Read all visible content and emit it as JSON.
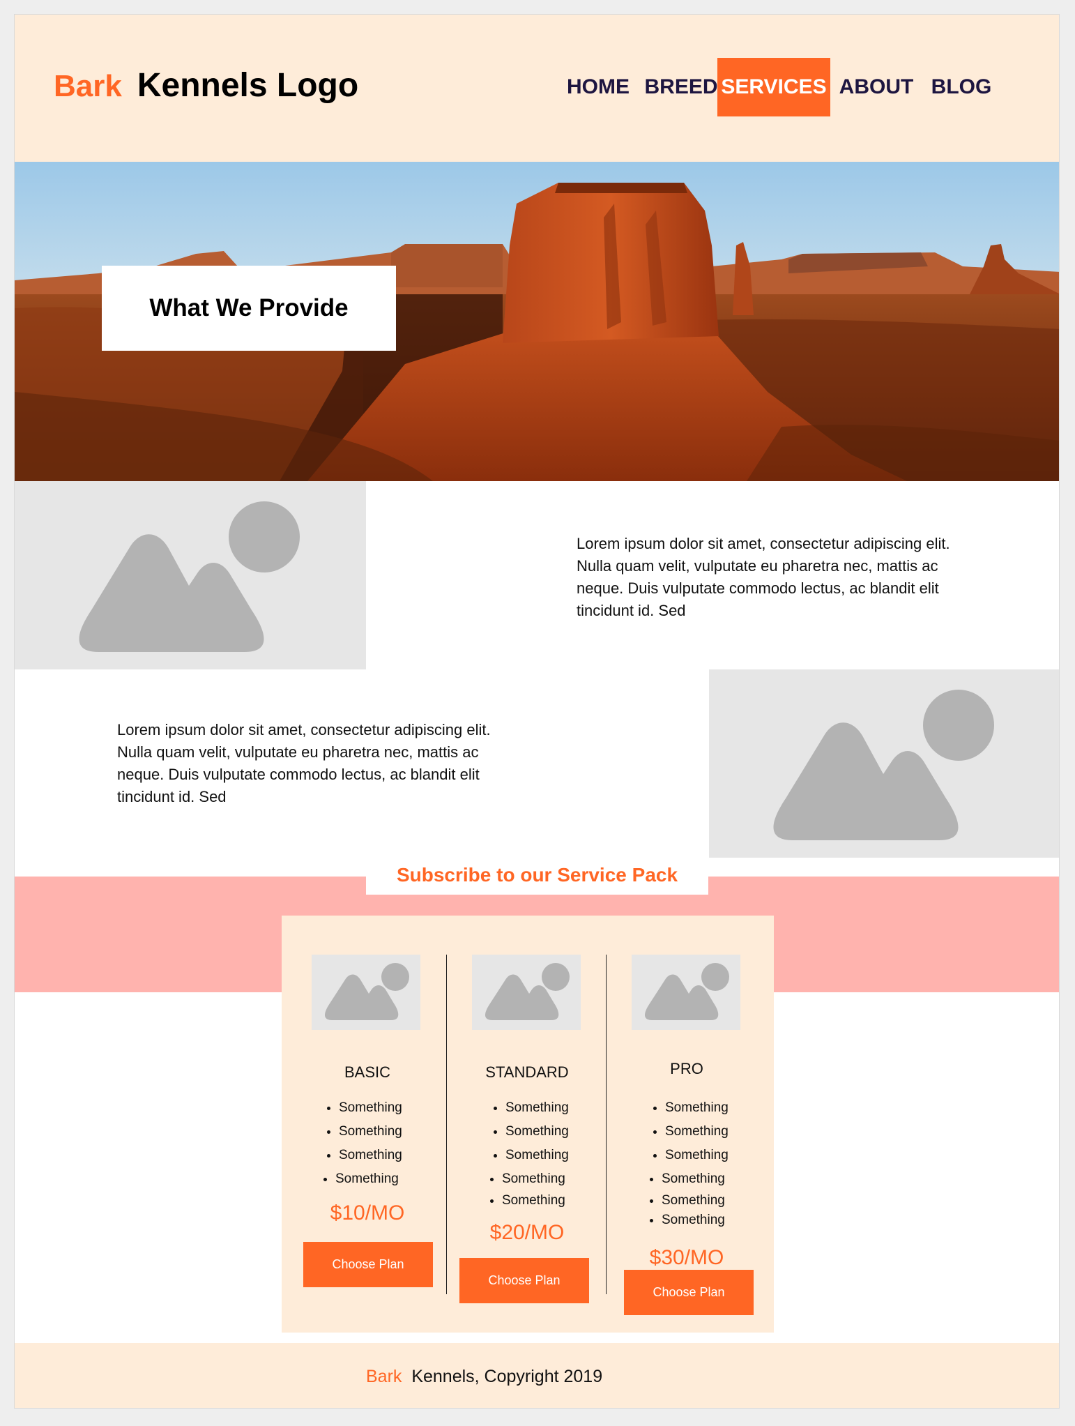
{
  "logo": {
    "accent": "Bark",
    "rest": "Kennels Logo"
  },
  "nav": [
    {
      "label": "HOME",
      "active": false
    },
    {
      "label": "BREED",
      "active": false
    },
    {
      "label": "SERVICES",
      "active": true
    },
    {
      "label": "ABOUT",
      "active": false
    },
    {
      "label": "BLOG",
      "active": false
    }
  ],
  "hero": {
    "title": "What We Provide"
  },
  "sections": [
    {
      "text": "Lorem ipsum dolor sit amet, consectetur adipiscing elit. Nulla quam velit, vulputate eu pharetra nec, mattis ac neque. Duis vulputate commodo lectus, ac blandit elit tincidunt id. Sed"
    },
    {
      "text": "Lorem ipsum dolor sit amet, consectetur adipiscing elit. Nulla quam velit, vulputate eu pharetra nec, mattis ac neque. Duis vulputate commodo lectus, ac blandit elit tincidunt id. Sed"
    }
  ],
  "subscribe": {
    "title": "Subscribe to our Service Pack"
  },
  "plans": [
    {
      "name": "BASIC",
      "features": [
        "Something",
        "Something",
        "Something",
        "Something"
      ],
      "price": "$10/MO",
      "button": "Choose Plan"
    },
    {
      "name": "STANDARD",
      "features": [
        "Something",
        "Something",
        "Something",
        "Something",
        "Something"
      ],
      "price": "$20/MO",
      "button": "Choose Plan"
    },
    {
      "name": "PRO",
      "features": [
        "Something",
        "Something",
        "Something",
        "Something",
        "Something",
        "Something"
      ],
      "price": "$30/MO",
      "button": "Choose Plan"
    }
  ],
  "footer": {
    "accent": "Bark",
    "rest": "Kennels, Copyright 2019"
  },
  "colors": {
    "accent": "#ff6624",
    "header_bg": "#feecd9",
    "band_bg": "#ffb3ae",
    "nav_text": "#1d1540"
  },
  "icons": {
    "placeholder": "image-placeholder-icon"
  }
}
